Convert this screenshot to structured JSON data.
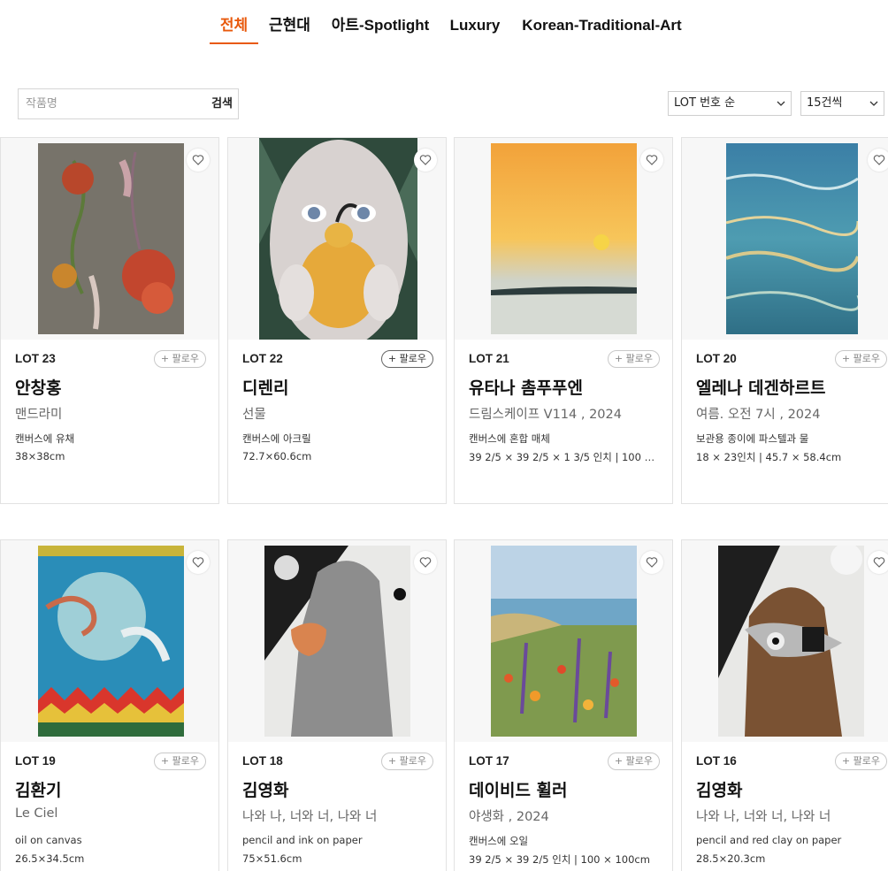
{
  "tabs": [
    {
      "label": "전체",
      "active": true
    },
    {
      "label": "근현대"
    },
    {
      "label": "아트-Spotlight"
    },
    {
      "label": "Luxury"
    },
    {
      "label": "Korean-Traditional-Art"
    }
  ],
  "search": {
    "placeholder": "작품명",
    "button": "검색"
  },
  "sort": {
    "value": "LOT 번호 순"
  },
  "page_size": {
    "value": "15건씩"
  },
  "follow_label": "+ 팔로우",
  "accent_color": "#e8590c",
  "lots": [
    {
      "lot": "LOT 23",
      "artist": "안창홍",
      "title": "맨드라미",
      "medium": "캔버스에 유채",
      "size": "38×38cm"
    },
    {
      "lot": "LOT 22",
      "artist": "디렌리",
      "title": "선물",
      "medium": "캔버스에 아크릴",
      "size": "72.7×60.6cm"
    },
    {
      "lot": "LOT 21",
      "artist": "유타나 촘푸푸엔",
      "title": "드림스케이프 V114 , 2024",
      "medium": "캔버스에 혼합 매체",
      "size": "39 2/5 × 39 2/5 × 1 3/5 인치 | 100 × …"
    },
    {
      "lot": "LOT 20",
      "artist": "엘레나 데겐하르트",
      "title": "여름. 오전 7시 , 2024",
      "medium": "보관용 종이에 파스텔과 물",
      "size": "18 × 23인치 | 45.7 × 58.4cm"
    },
    {
      "lot": "LOT 19",
      "artist": "김환기",
      "title": "Le Ciel",
      "medium": "oil on canvas",
      "size": "26.5×34.5cm"
    },
    {
      "lot": "LOT 18",
      "artist": "김영화",
      "title": "나와 나, 너와 너, 나와 너",
      "medium": "pencil and ink on paper",
      "size": "75×51.6cm"
    },
    {
      "lot": "LOT 17",
      "artist": "데이비드 휠러",
      "title": "야생화 , 2024",
      "medium": "캔버스에 오일",
      "size": "39 2/5 × 39 2/5 인치 | 100 × 100cm"
    },
    {
      "lot": "LOT 16",
      "artist": "김영화",
      "title": "나와 나, 너와 너, 나와 너",
      "medium": "pencil and red clay on paper",
      "size": "28.5×20.3cm"
    }
  ]
}
